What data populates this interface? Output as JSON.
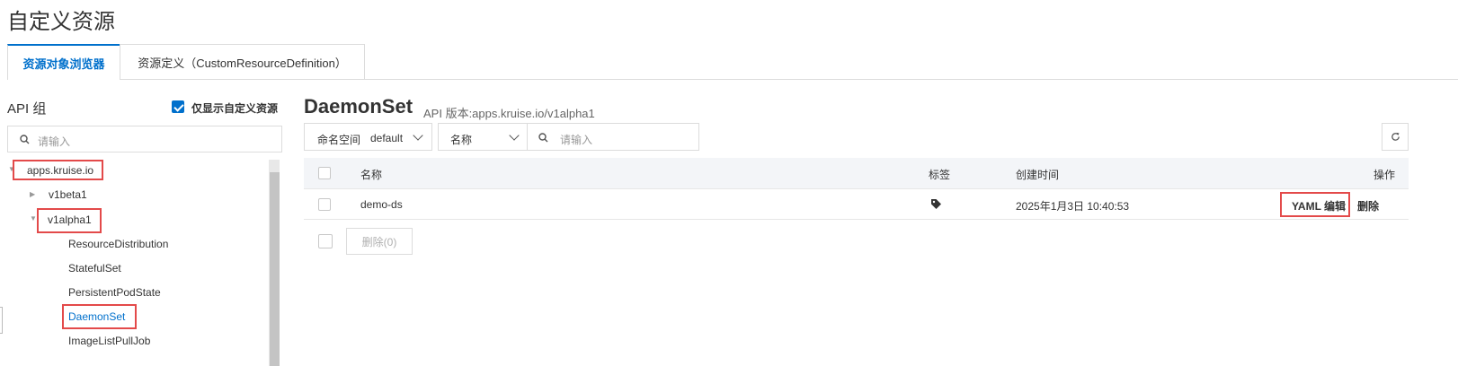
{
  "page": {
    "title": "自定义资源"
  },
  "tabs": [
    {
      "label": "资源对象浏览器",
      "active": true
    },
    {
      "label": "资源定义（CustomResourceDefinition）",
      "active": false
    }
  ],
  "sidebar": {
    "title": "API 组",
    "filter_checkbox_label": "仅显示自定义资源",
    "filter_checked": true,
    "search_placeholder": "请输入",
    "tree": {
      "group": "apps.kruise.io",
      "versions": [
        {
          "label": "v1beta1",
          "expanded": false
        },
        {
          "label": "v1alpha1",
          "expanded": true,
          "children": [
            "ResourceDistribution",
            "StatefulSet",
            "PersistentPodState",
            "DaemonSet",
            "ImageListPullJob"
          ]
        }
      ],
      "selected": "DaemonSet"
    }
  },
  "main": {
    "resource_title": "DaemonSet",
    "api_version": "API 版本:apps.kruise.io/v1alpha1",
    "namespace_label": "命名空间",
    "namespace_value": "default",
    "filter_field": "名称",
    "search_placeholder": "请输入",
    "table": {
      "headers": {
        "name": "名称",
        "labels": "标签",
        "created": "创建时间",
        "actions": "操作"
      },
      "rows": [
        {
          "name": "demo-ds",
          "created": "2025年1月3日 10:40:53",
          "action_edit": "YAML 编辑",
          "action_delete": "删除"
        }
      ]
    },
    "bulk_delete_label": "删除(0)"
  },
  "colors": {
    "accent": "#0070cc",
    "highlight": "#e34a4a"
  },
  "icons": [
    "search-icon",
    "refresh-icon",
    "tag-icon",
    "chevron-down-icon",
    "tree-caret-icon"
  ]
}
